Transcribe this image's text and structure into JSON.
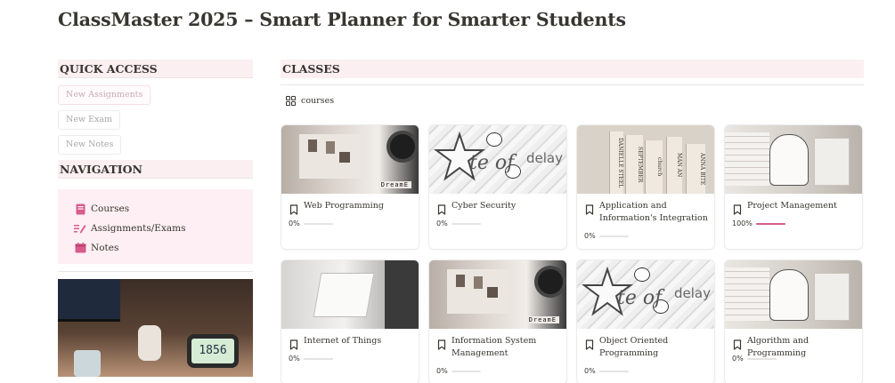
{
  "page": {
    "title": "ClassMaster 2025 – Smart Planner for Smarter Students"
  },
  "quick_access": {
    "heading": "QUICK ACCESS",
    "buttons": [
      {
        "label": "New Assignments",
        "style": "pink"
      },
      {
        "label": "New Exam",
        "style": "plain"
      },
      {
        "label": "New Notes",
        "style": "plain"
      }
    ]
  },
  "navigation": {
    "heading": "NAVIGATION",
    "items": [
      {
        "label": "Courses",
        "icon": "book-icon"
      },
      {
        "label": "Assignments/Exams",
        "icon": "pencil-list-icon"
      },
      {
        "label": "Notes",
        "icon": "calendar-icon"
      }
    ]
  },
  "sidebar_photo": {
    "clock_text": "1856"
  },
  "classes": {
    "heading": "CLASSES",
    "view_tab": {
      "label": "courses",
      "icon": "gallery-grid-icon"
    },
    "cards": [
      {
        "title": "Web Programming",
        "progress_label": "0%",
        "progress": 0,
        "cover": "desk",
        "cover_text": "DreamE"
      },
      {
        "title": "Cyber Security",
        "progress_label": "0%",
        "progress": 0,
        "cover": "paper",
        "cover_text_1": "te of",
        "cover_text_2": "delay"
      },
      {
        "title": "Application and Information's Integration",
        "progress_label": "0%",
        "progress": 0,
        "cover": "books",
        "spines": [
          "DANIELLE STEEL",
          "SEPTEMBER",
          "church",
          "MAN AN",
          "ANNA BITE"
        ]
      },
      {
        "title": "Project Management",
        "progress_label": "100%",
        "progress": 1,
        "cover": "snoopy"
      },
      {
        "title": "Internet of Things",
        "progress_label": "0%",
        "progress": 0,
        "cover": "white"
      },
      {
        "title": "Information System Management",
        "progress_label": "0%",
        "progress": 0,
        "cover": "desk",
        "cover_text": "DreamE"
      },
      {
        "title": "Object Oriented Programming",
        "progress_label": "0%",
        "progress": 0,
        "cover": "paper",
        "cover_text_1": "te of",
        "cover_text_2": "delay"
      },
      {
        "title": "Algorithm and Programming",
        "progress_label": "0%",
        "progress": 0,
        "cover": "snoopy"
      }
    ]
  },
  "colors": {
    "accent": "#d85b8c",
    "section_bg": "#fbeff2",
    "nav_bg": "#fdeff3"
  }
}
